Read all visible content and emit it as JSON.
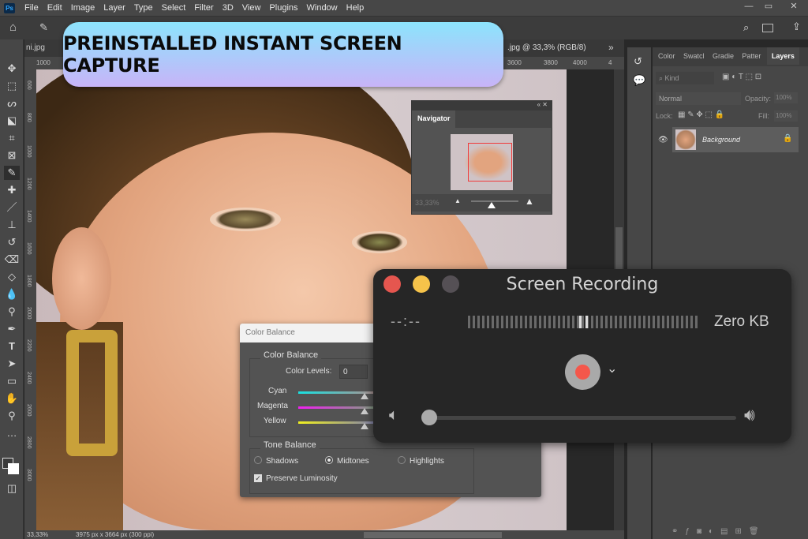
{
  "menubar": {
    "logo": "Ps",
    "items": [
      "File",
      "Edit",
      "Image",
      "Layer",
      "Type",
      "Select",
      "Filter",
      "3D",
      "View",
      "Plugins",
      "Window",
      "Help"
    ]
  },
  "window_controls": {
    "minimize": "—",
    "maximize": "▭",
    "close": "✕"
  },
  "banner": {
    "text": "PREINSTALLED INSTANT SCREEN CAPTURE"
  },
  "document": {
    "tab_left": "ni.jpg",
    "tab_right": ".jpg @ 33,3% (RGB/8)",
    "zoom": "33,33%",
    "dimensions": "3975 px x 3664 px (300 ppi)"
  },
  "ruler": {
    "top": [
      "1000",
      "3600",
      "3800",
      "4000",
      "4"
    ],
    "left": [
      "600",
      "800",
      "1000",
      "1200",
      "1400",
      "1600",
      "1800",
      "2000",
      "2200",
      "2400",
      "2600",
      "2800",
      "3000"
    ]
  },
  "navigator": {
    "title": "Navigator",
    "zoom": "33,33%",
    "zoom_slider": 0.45
  },
  "layers": {
    "tabs": [
      "Color",
      "Swatcl",
      "Gradie",
      "Patter",
      "Layers"
    ],
    "active_tab": "Layers",
    "filter": "Kind",
    "blend_mode": "Normal",
    "opacity_label": "Opacity:",
    "opacity": "100%",
    "lock_label": "Lock:",
    "fill_label": "Fill:",
    "fill": "100%",
    "layer_name": "Background"
  },
  "color_balance": {
    "title": "Color Balance",
    "group1": "Color Balance",
    "levels_label": "Color Levels:",
    "levels_value": "0",
    "sliders": [
      {
        "label": "Cyan",
        "value": 0
      },
      {
        "label": "Magenta",
        "value": 0
      },
      {
        "label": "Yellow",
        "value": 0
      }
    ],
    "group2": "Tone Balance",
    "tones": [
      "Shadows",
      "Midtones",
      "Highlights"
    ],
    "selected_tone": "Midtones",
    "preserve": "Preserve Luminosity",
    "preserve_checked": true
  },
  "recorder": {
    "title": "Screen Recording",
    "time": "--:--",
    "size": "Zero KB",
    "volume": 0.0,
    "colors": {
      "close": "#e5564f",
      "minimize": "#f6c34a",
      "zoom": "#555055",
      "record": "#f4574b"
    }
  }
}
